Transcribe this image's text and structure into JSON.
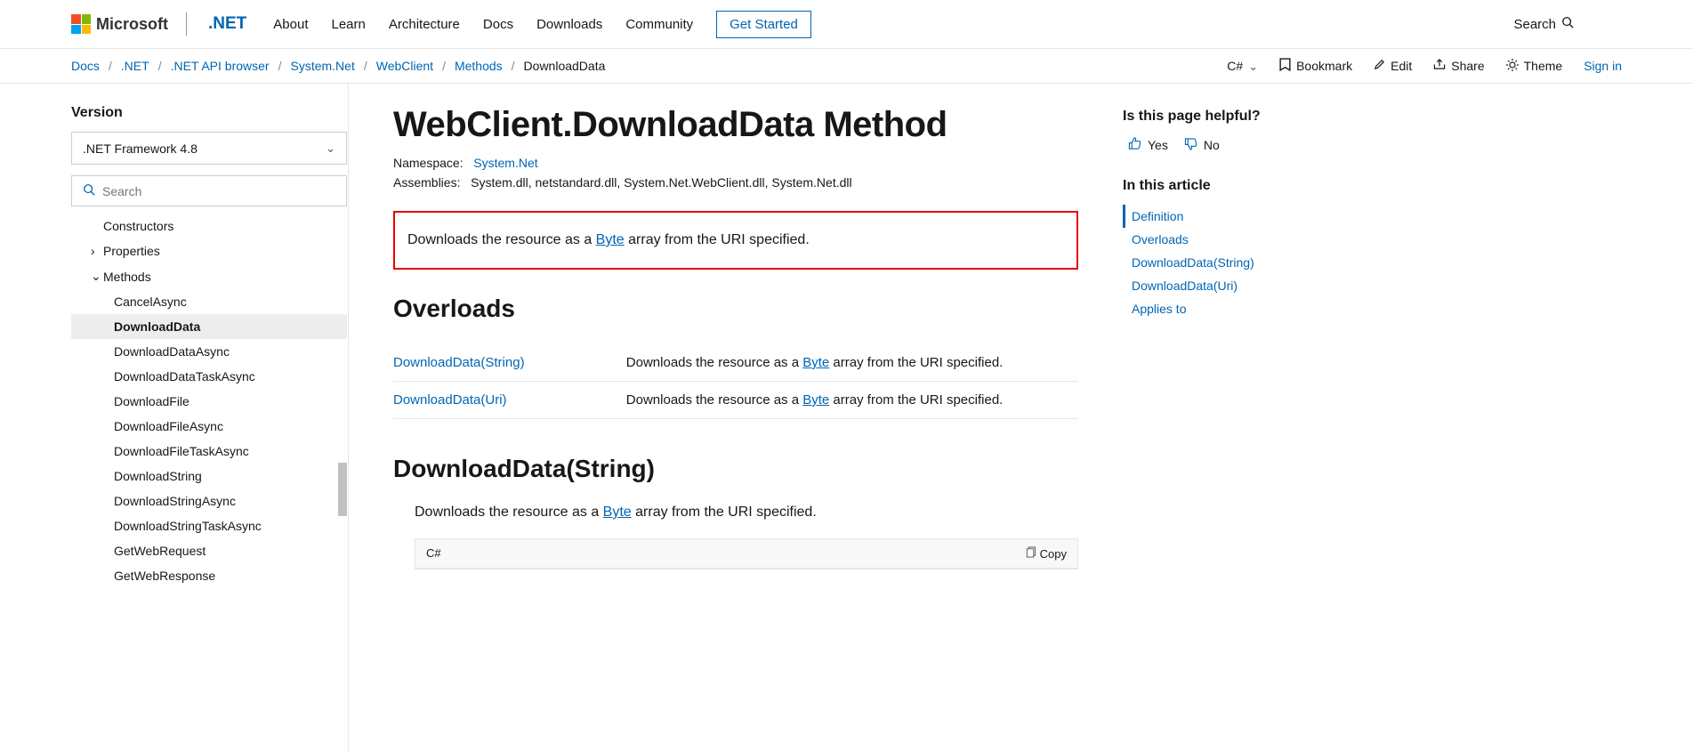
{
  "topnav": {
    "ms": "Microsoft",
    "brand": ".NET",
    "links": [
      "About",
      "Learn",
      "Architecture",
      "Docs",
      "Downloads",
      "Community"
    ],
    "get_started": "Get Started",
    "search": "Search"
  },
  "breadcrumb": {
    "items": [
      "Docs",
      ".NET",
      ".NET API browser",
      "System.Net",
      "WebClient",
      "Methods"
    ],
    "current": "DownloadData"
  },
  "actions": {
    "lang": "C#",
    "bookmark": "Bookmark",
    "edit": "Edit",
    "share": "Share",
    "theme": "Theme",
    "signin": "Sign in"
  },
  "sidebar": {
    "version_label": "Version",
    "version_value": ".NET Framework 4.8",
    "search_placeholder": "Search",
    "items": [
      {
        "label": "Constructors",
        "level": 1,
        "expand": ""
      },
      {
        "label": "Properties",
        "level": 1,
        "expand": "›"
      },
      {
        "label": "Methods",
        "level": 1,
        "expand": "⌄"
      },
      {
        "label": "CancelAsync",
        "level": 2
      },
      {
        "label": "DownloadData",
        "level": 2,
        "active": true
      },
      {
        "label": "DownloadDataAsync",
        "level": 2
      },
      {
        "label": "DownloadDataTaskAsync",
        "level": 2
      },
      {
        "label": "DownloadFile",
        "level": 2
      },
      {
        "label": "DownloadFileAsync",
        "level": 2
      },
      {
        "label": "DownloadFileTaskAsync",
        "level": 2
      },
      {
        "label": "DownloadString",
        "level": 2
      },
      {
        "label": "DownloadStringAsync",
        "level": 2
      },
      {
        "label": "DownloadStringTaskAsync",
        "level": 2
      },
      {
        "label": "GetWebRequest",
        "level": 2
      },
      {
        "label": "GetWebResponse",
        "level": 2
      }
    ]
  },
  "main": {
    "title": "WebClient.DownloadData Method",
    "namespace_label": "Namespace:",
    "namespace_value": "System.Net",
    "assemblies_label": "Assemblies:",
    "assemblies_value": "System.dll, netstandard.dll, System.Net.WebClient.dll, System.Net.dll",
    "desc_pre": "Downloads the resource as a ",
    "desc_link": "Byte",
    "desc_post": " array from the URI specified.",
    "overloads_heading": "Overloads",
    "overloads": [
      {
        "name": "DownloadData(String)",
        "desc_pre": "Downloads the resource as a ",
        "desc_link": "Byte",
        "desc_post": " array from the URI specified."
      },
      {
        "name": "DownloadData(Uri)",
        "desc_pre": "Downloads the resource as a ",
        "desc_link": "Byte",
        "desc_post": " array from the URI specified."
      }
    ],
    "section2_heading": "DownloadData(String)",
    "section2_desc_pre": "Downloads the resource as a ",
    "section2_desc_link": "Byte",
    "section2_desc_post": " array from the URI specified.",
    "code_lang": "C#",
    "copy": "Copy"
  },
  "right": {
    "helpful": "Is this page helpful?",
    "yes": "Yes",
    "no": "No",
    "toc_title": "In this article",
    "toc": [
      {
        "label": "Definition",
        "active": true
      },
      {
        "label": "Overloads"
      },
      {
        "label": "DownloadData(String)"
      },
      {
        "label": "DownloadData(Uri)"
      },
      {
        "label": "Applies to"
      }
    ]
  }
}
